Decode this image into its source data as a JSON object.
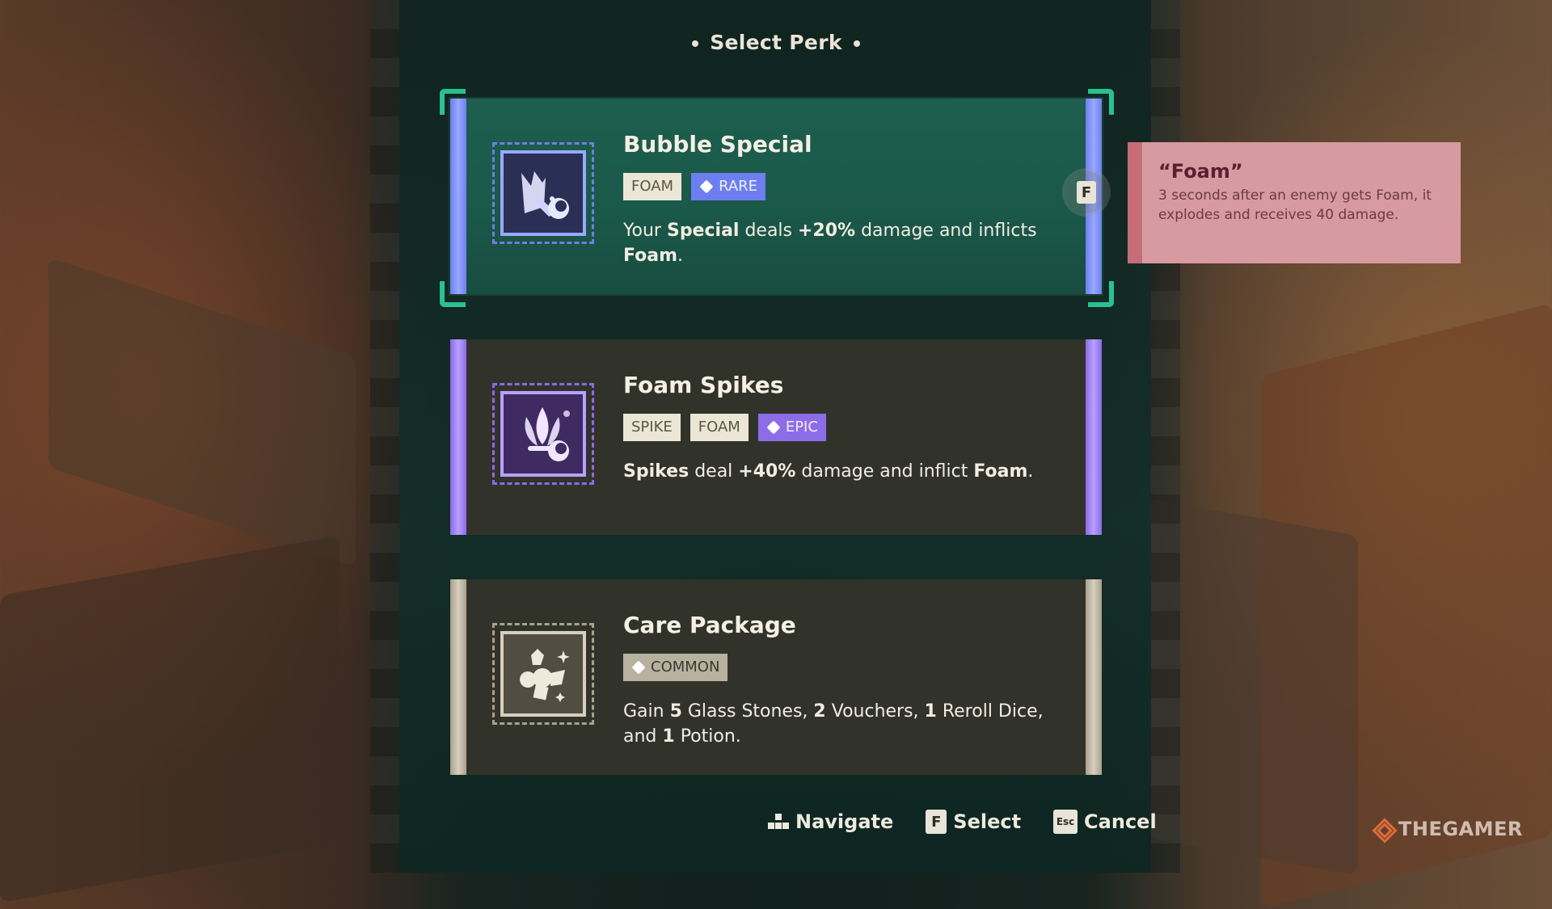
{
  "header": {
    "title": "Select Perk"
  },
  "perks": [
    {
      "title": "Bubble Special",
      "rarity": "RARE",
      "tags": [
        "FOAM"
      ],
      "desc": {
        "p1": "Your ",
        "b1": "Special",
        "p2": " deals ",
        "b2": "+20%",
        "p3": " damage and inflicts ",
        "b3": "Foam",
        "p4": "."
      },
      "icon": "bubble-special-icon",
      "color": "#6d7ff0"
    },
    {
      "title": "Foam Spikes",
      "rarity": "EPIC",
      "tags": [
        "SPIKE",
        "FOAM"
      ],
      "desc": {
        "b1": "Spikes",
        "p1": " deal ",
        "b2": "+40%",
        "p2": " damage and inflict ",
        "b3": "Foam",
        "p3": "."
      },
      "icon": "foam-spikes-icon",
      "color": "#8d6ce8"
    },
    {
      "title": "Care Package",
      "rarity": "COMMON",
      "tags": [],
      "desc": {
        "p1": "Gain ",
        "b1": "5",
        "p2": " Glass Stones, ",
        "b2": "2",
        "p3": " Vouchers, ",
        "b3": "1",
        "p4": " Reroll Dice, and ",
        "b4": "1",
        "p5": " Potion."
      },
      "icon": "care-package-icon",
      "color": "#b9b1a0"
    }
  ],
  "select_key": "F",
  "tooltip": {
    "title": "“Foam”",
    "body": "3 seconds after an enemy gets Foam, it explodes and receives 40 damage."
  },
  "footer": {
    "navigate_label": "Navigate",
    "select_key": "F",
    "select_label": "Select",
    "cancel_key": "Esc",
    "cancel_label": "Cancel"
  },
  "watermark": "THEGAMER"
}
